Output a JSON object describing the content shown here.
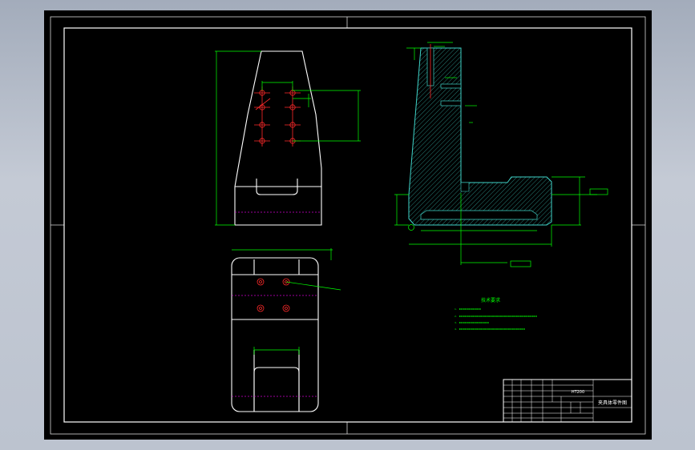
{
  "title_block": {
    "drawing_name": "夹具体零件图",
    "material_code": "HT200"
  },
  "technical_requirements": {
    "heading": "技术要求",
    "items": [
      "1.",
      "2.",
      "3.",
      "4."
    ]
  }
}
